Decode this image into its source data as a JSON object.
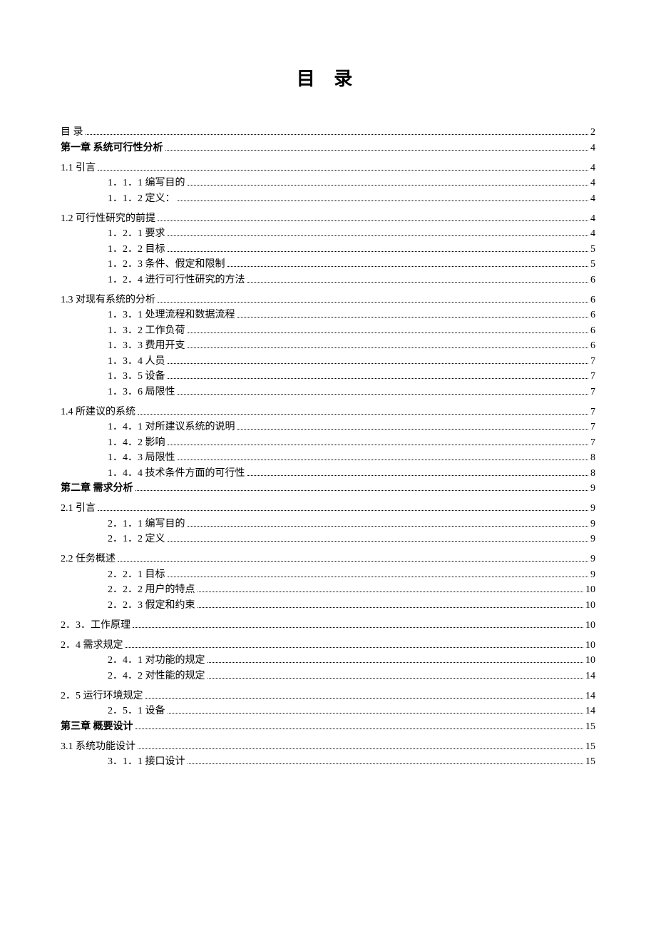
{
  "title": "目 录",
  "entries": [
    {
      "level": 1,
      "label": "目 录",
      "page": "2"
    },
    {
      "level": 1,
      "bold": true,
      "label": "第一章 系统可行性分析",
      "page": "4"
    },
    {
      "level": 2,
      "label": "1.1 引言",
      "page": "4"
    },
    {
      "level": 3,
      "label": "1．1．1 编写目的",
      "page": "4"
    },
    {
      "level": 3,
      "label": "1．1．2  定义：",
      "page": "4"
    },
    {
      "level": 2,
      "label": "1.2 可行性研究的前提",
      "page": "4"
    },
    {
      "level": 3,
      "label": "1．2．1 要求",
      "page": "4"
    },
    {
      "level": 3,
      "label": "1．2．2 目标",
      "page": "5"
    },
    {
      "level": 3,
      "label": "1．2．3 条件、假定和限制",
      "page": "5"
    },
    {
      "level": 3,
      "label": "1．2．4 进行可行性研究的方法",
      "page": "6"
    },
    {
      "level": 2,
      "label": "1.3  对现有系统的分析",
      "page": "6"
    },
    {
      "level": 3,
      "label": "1．3．1 处理流程和数据流程",
      "page": "6"
    },
    {
      "level": 3,
      "label": "1．3．2 工作负荷",
      "page": "6"
    },
    {
      "level": 3,
      "label": "1．3．3 费用开支",
      "page": "6"
    },
    {
      "level": 3,
      "label": "1．3．4 人员",
      "page": "7"
    },
    {
      "level": 3,
      "label": "1．3．5 设备",
      "page": "7"
    },
    {
      "level": 3,
      "label": "1．3．6 局限性",
      "page": "7"
    },
    {
      "level": 2,
      "label": "1.4  所建议的系统",
      "page": "7"
    },
    {
      "level": 3,
      "label": "1．4．1 对所建议系统的说明",
      "page": "7"
    },
    {
      "level": 3,
      "label": "1．4．2 影响",
      "page": "7"
    },
    {
      "level": 3,
      "label": "1．4．3 局限性",
      "page": "8"
    },
    {
      "level": 3,
      "label": "1．4．4 技术条件方面的可行性",
      "page": "8"
    },
    {
      "level": 1,
      "bold": true,
      "label": "第二章 需求分析",
      "page": "9"
    },
    {
      "level": 2,
      "label": "2.1 引言",
      "page": "9"
    },
    {
      "level": 3,
      "label": "2．1．1 编写目的",
      "page": "9"
    },
    {
      "level": 3,
      "label": "2．1．2  定义",
      "page": "9"
    },
    {
      "level": 2,
      "label": "2.2 任务概述",
      "page": "9"
    },
    {
      "level": 3,
      "label": "2．2．1 目标",
      "page": "9"
    },
    {
      "level": 3,
      "label": "2．2．2 用户的特点",
      "page": "10"
    },
    {
      "level": 3,
      "label": "2．2．3 假定和约束",
      "page": "10"
    },
    {
      "level": 2,
      "label": "2．3．工作原理",
      "page": "10"
    },
    {
      "level": 2,
      "label": "2．4 需求规定",
      "page": "10"
    },
    {
      "level": 3,
      "label": "2．4．1 对功能的规定",
      "page": "10"
    },
    {
      "level": 3,
      "label": "2．4．2 对性能的规定",
      "page": "14"
    },
    {
      "level": 2,
      "label": "2．5 运行环境规定",
      "page": "14"
    },
    {
      "level": 3,
      "label": "2．5．1 设备",
      "page": "14"
    },
    {
      "level": 1,
      "bold": true,
      "label": "第三章 概要设计",
      "page": "15"
    },
    {
      "level": 2,
      "label": "3.1  系统功能设计",
      "page": "15"
    },
    {
      "level": 3,
      "label": "3．1．1 接口设计",
      "page": "15"
    }
  ]
}
